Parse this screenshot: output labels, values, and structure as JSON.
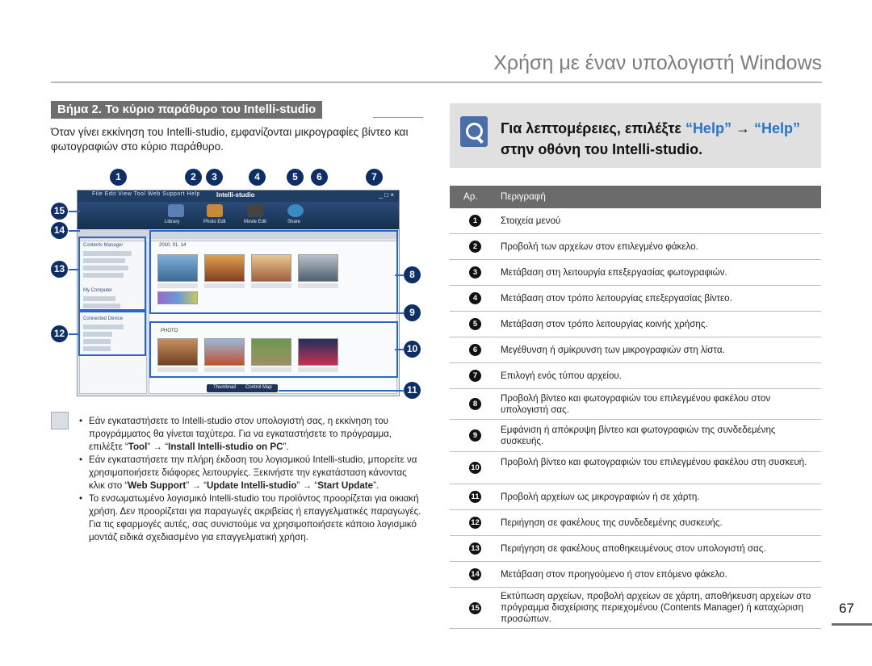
{
  "header": {
    "title": "Χρήση με έναν υπολογιστή Windows"
  },
  "section": {
    "heading": "Βήμα 2. Το κύριο παράθυρο του Intelli-studio",
    "intro": "Όταν γίνει εκκίνηση του Intelli-studio, εμφανίζονται μικρογραφίες βίντεο και φωτογραφιών στο κύριο παράθυρο."
  },
  "figure": {
    "callouts": [
      "1",
      "2",
      "3",
      "4",
      "5",
      "6",
      "7",
      "8",
      "9",
      "10",
      "11",
      "12",
      "13",
      "14",
      "15"
    ],
    "window": {
      "menu": "File  Edit  View  Tool  Web Support  Help",
      "logo": "Intelli-studio",
      "controls": "_ □ ×",
      "toolbar": [
        "Library",
        "Photo Edit",
        "Movie Edit",
        "Share"
      ],
      "left_panel": [
        "Contents Manager",
        "My Computer",
        "Connected Device"
      ],
      "main_label_top": "2010. 01. 14",
      "main_label_bottom": "PHOTO",
      "status_buttons": [
        "Thumbnail",
        "Control Map"
      ]
    }
  },
  "note": {
    "bullets": [
      {
        "parts": [
          "Εάν εγκαταστήσετε το Intelli-studio στον υπολογιστή σας, η εκκίνηση του προγράμματος θα γίνεται ταχύτερα. Για να εγκαταστήσετε το πρόγραμμα, επιλέξτε “",
          "Tool",
          "” → “",
          "Install Intelli-studio on PC",
          "”."
        ]
      },
      {
        "parts": [
          "Εάν εγκαταστήσετε την πλήρη έκδοση του λογισμικού Intelli-studio, μπορείτε να χρησιμοποιήσετε διάφορες λειτουργίες. Ξεκινήστε την εγκατάσταση κάνοντας κλικ στο “",
          "Web Support",
          "” → “",
          "Update Intelli-studio",
          "” → “",
          "Start Update",
          "”."
        ]
      },
      {
        "parts": [
          "Το ενσωματωμένο λογισμικό Intelli-studio του προϊόντος προορίζεται για οικιακή χρήση. Δεν προορίζεται για παραγωγές ακριβείας ή επαγγελματικές παραγωγές. Για τις εφαρμογές αυτές, σας συνιστούμε να χρησιμοποιήσετε κάποιο λογισμικό μοντάζ ειδικά σχεδιασμένο για επαγγελματική χρήση."
        ]
      }
    ]
  },
  "help": {
    "prefix": "Για λεπτομέρειες, επιλέξτε ",
    "link1": "“Help”",
    "arrow": " → ",
    "link2": "“Help”",
    "suffix": "στην οθόνη του Intelli-studio."
  },
  "table": {
    "headers": {
      "num": "Αρ.",
      "desc": "Περιγραφή"
    },
    "rows": [
      {
        "num": "1",
        "desc": "Στοιχεία μενού"
      },
      {
        "num": "2",
        "desc": "Προβολή των αρχείων στον επιλεγμένο φάκελο."
      },
      {
        "num": "3",
        "desc": "Μετάβαση στη λειτουργία επεξεργασίας φωτογραφιών."
      },
      {
        "num": "4",
        "desc": "Μετάβαση στον τρόπο λειτουργίας επεξεργασίας βίντεο."
      },
      {
        "num": "5",
        "desc": "Μετάβαση στον τρόπο λειτουργίας κοινής χρήσης."
      },
      {
        "num": "6",
        "desc": "Μεγέθυνση ή σμίκρυνση των μικρογραφιών στη λίστα."
      },
      {
        "num": "7",
        "desc": "Επιλογή ενός τύπου αρχείου."
      },
      {
        "num": "8",
        "desc": "Προβολή βίντεο και φωτογραφιών του επιλεγμένου φακέλου στον υπολογιστή σας."
      },
      {
        "num": "9",
        "desc": "Εμφάνιση ή απόκρυψη βίντεο και φωτογραφιών της συνδεδεμένης συσκευής."
      },
      {
        "num": "10",
        "desc": "Προβολή βίντεο και φωτογραφιών του επιλεγμένου φακέλου στη συσκευή."
      },
      {
        "num": "11",
        "desc": "Προβολή αρχείων ως μικρογραφιών ή σε χάρτη."
      },
      {
        "num": "12",
        "desc": "Περιήγηση σε φακέλους της συνδεδεμένης συσκευής."
      },
      {
        "num": "13",
        "desc": "Περιήγηση σε φακέλους αποθηκευμένους στον υπολογιστή σας."
      },
      {
        "num": "14",
        "desc": "Μετάβαση στον προηγούμενο ή στον επόμενο φάκελο."
      },
      {
        "num": "15",
        "desc": "Εκτύπωση αρχείων, προβολή αρχείων σε χάρτη, αποθήκευση αρχείων στο πρόγραμμα διαχείρισης περιεχομένου (Contents Manager) ή καταχώριση προσώπων."
      }
    ]
  },
  "page": {
    "number": "67"
  }
}
